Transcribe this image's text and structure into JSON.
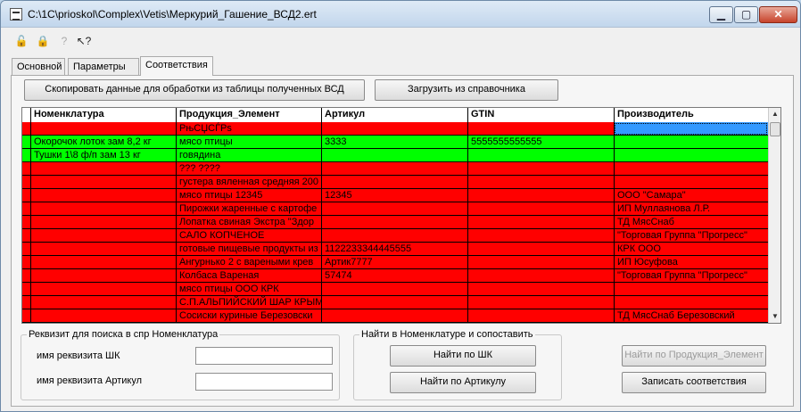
{
  "window": {
    "title": "C:\\1C\\prioskol\\Complex\\Vetis\\Меркурий_Гашение_ВСД2.ert",
    "controls": {
      "minimize": "▁",
      "maximize": "▢",
      "close": "✕"
    }
  },
  "toolbar": {
    "icons": [
      "lock-open-icon",
      "lock-icon",
      "help-icon",
      "pointer-help-icon"
    ],
    "glyphs": [
      "🔓",
      "🔒",
      "?",
      "↖?"
    ]
  },
  "tabs": [
    "Основной",
    "Параметры",
    "Соответствия"
  ],
  "active_tab": "Соответствия",
  "buttons": {
    "copy": "Скопировать данные для обработки из таблицы полученных ВСД",
    "load": "Загрузить из справочника",
    "find_shk": "Найти по ШК",
    "find_article": "Найти по Артикулу",
    "find_product": "Найти по Продукция_Элемент",
    "save": "Записать соответствия"
  },
  "grid": {
    "columns": [
      "Номенклатура",
      "Продукция_Элемент",
      "Артикул",
      "GTIN",
      "Производитель"
    ],
    "rows": [
      {
        "status": "red",
        "cells": [
          "",
          "РњСЏСЃРѕ",
          "",
          "",
          ""
        ]
      },
      {
        "status": "green",
        "cells": [
          "Окорочок лоток зам 8,2 кг",
          "мясо птицы",
          "3333",
          "5555555555555",
          ""
        ]
      },
      {
        "status": "green",
        "cells": [
          "Тушки 1\\8 ф/п зам 13 кг",
          "говядина",
          "",
          "",
          ""
        ]
      },
      {
        "status": "red",
        "cells": [
          "",
          "??? ????",
          "",
          "",
          ""
        ]
      },
      {
        "status": "red",
        "cells": [
          "",
          "густера вяленная средняя 200",
          "",
          "",
          ""
        ]
      },
      {
        "status": "red",
        "cells": [
          "",
          "мясо птицы 12345",
          "12345",
          "",
          "ООО \"Самара\""
        ]
      },
      {
        "status": "red",
        "cells": [
          "",
          "Пирожки жаренные с картофе",
          "",
          "",
          "ИП Муллаянова Л.Р."
        ]
      },
      {
        "status": "red",
        "cells": [
          "",
          "Лопатка свиная Экстра \"Здор",
          "",
          "",
          "ТД МясСнаб"
        ]
      },
      {
        "status": "red",
        "cells": [
          "",
          "САЛО КОПЧЕНОЕ",
          "",
          "",
          "\"Торговая Группа \"Прогресс\""
        ]
      },
      {
        "status": "red",
        "cells": [
          "",
          "готовые пищевые продукты из",
          "1122233344445555",
          "",
          "КРК ООО"
        ]
      },
      {
        "status": "red",
        "cells": [
          "",
          "Ангурнько 2 с вареными крев",
          "Артик7777",
          "",
          "ИП Юсуфова"
        ]
      },
      {
        "status": "red",
        "cells": [
          "",
          "Колбаса Вареная",
          "57474",
          "",
          "\"Торговая Группа \"Прогресс\""
        ]
      },
      {
        "status": "red",
        "cells": [
          "",
          "мясо птицы ООО КРК",
          "",
          "",
          ""
        ]
      },
      {
        "status": "red",
        "cells": [
          "",
          "С.П.АЛЬПИЙСКИЙ ШАР КРЫМ",
          "",
          "",
          ""
        ]
      },
      {
        "status": "red",
        "cells": [
          "",
          "Сосиски куриные Березовски",
          "",
          "",
          "ТД МясСнаб Березовский"
        ]
      }
    ],
    "selected_cell": {
      "row": 0,
      "column": "Производитель"
    }
  },
  "search_group": {
    "title": "Реквизит для поиска в спр Номенклатура",
    "shk_label": "имя реквизита ШК",
    "shk_value": "",
    "article_label": "имя реквизита Артикул",
    "article_value": ""
  },
  "match_group": {
    "title": "Найти в Номенклатуре и сопоставить"
  },
  "colors": {
    "row_unmatched": "#ff0000",
    "row_matched": "#00ff00",
    "selection": "#3399ff"
  }
}
